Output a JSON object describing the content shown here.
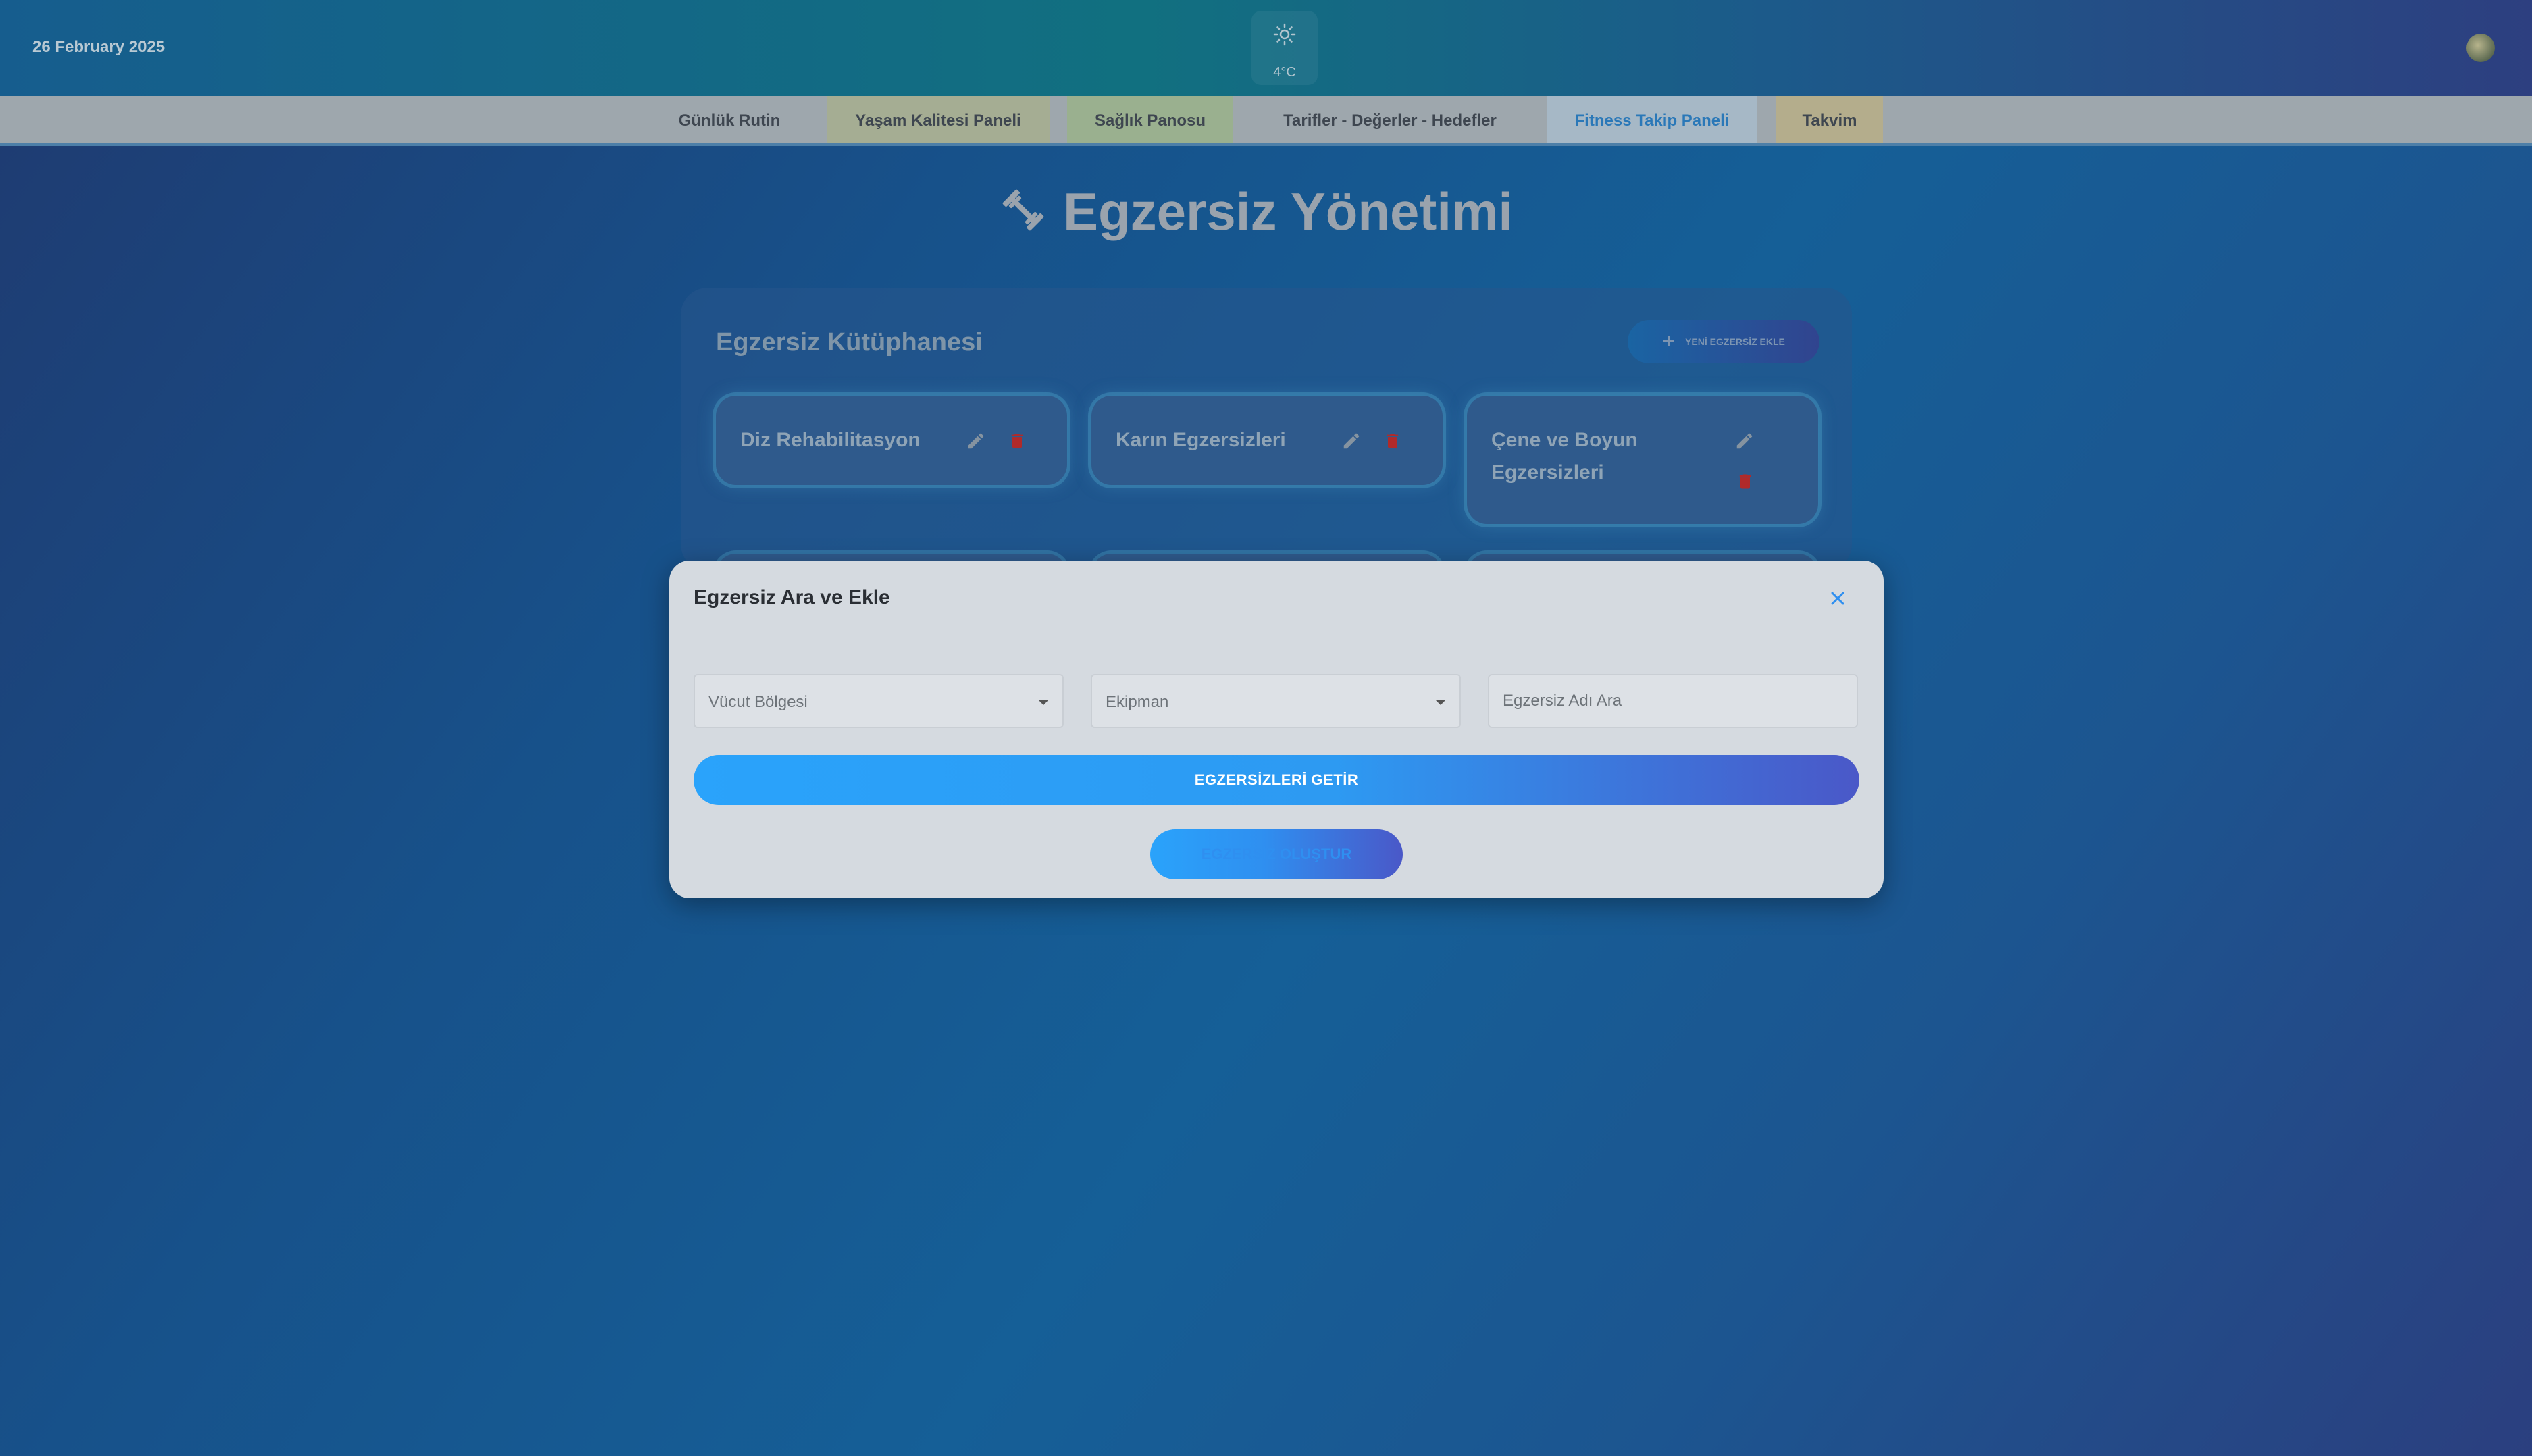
{
  "header": {
    "date": "26 February 2025",
    "weather": {
      "icon": "sun-icon",
      "temperature": "4°C"
    },
    "avatar": "avatar"
  },
  "nav": {
    "tabs": [
      {
        "label": "Günlük Rutin"
      },
      {
        "label": "Yaşam Kalitesi Paneli"
      },
      {
        "label": "Sağlık Panosu"
      },
      {
        "label": "Tarifler - Değerler - Hedefler"
      },
      {
        "label": "Fitness Takip Paneli",
        "active": true
      },
      {
        "label": "Takvim"
      }
    ]
  },
  "page": {
    "title": "Egzersiz Yönetimi",
    "title_icon": "dumbbell-icon"
  },
  "library": {
    "title": "Egzersiz Kütüphanesi",
    "new_button": "YENİ EGZERSİZ EKLE",
    "cards": [
      {
        "name": "Diz Rehabilitasyon"
      },
      {
        "name": "Karın Egzersizleri"
      },
      {
        "name_line1": "Çene ve Boyun",
        "name_line2": "Egzersizleri"
      }
    ]
  },
  "modal": {
    "title": "Egzersiz Ara ve Ekle",
    "body_region_select": "Vücut Bölgesi",
    "equipment_select": "Ekipman",
    "search_placeholder": "Egzersiz Adı Ara",
    "fetch_button": "EGZERSİZLERİ GETİR",
    "create_button": "EGZERSİZ OLUŞTUR"
  },
  "colors": {
    "accent": "#2aa3fb",
    "delete": "#c0392b",
    "active_tab": "#2a78b8"
  }
}
